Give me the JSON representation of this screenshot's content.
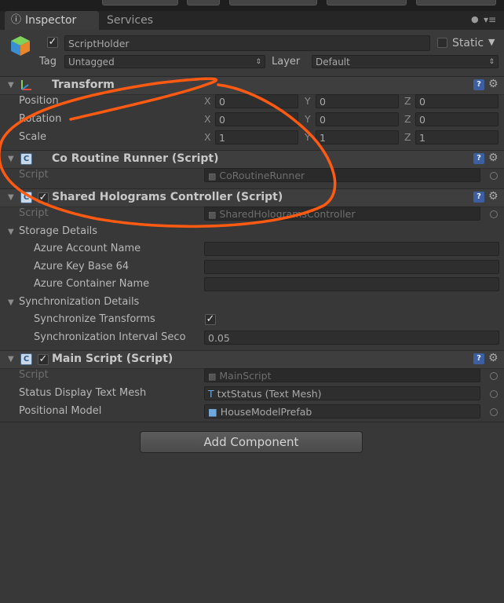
{
  "tabs": {
    "inspector": "Inspector",
    "services": "Services"
  },
  "icons": {
    "lock": "lock-icon",
    "menu": "tab-menu-icon"
  },
  "object": {
    "name": "ScriptHolder",
    "static_label": "Static"
  },
  "tag_layer": {
    "tag_label": "Tag",
    "tag_value": "Untagged",
    "layer_label": "Layer",
    "layer_value": "Default"
  },
  "transform": {
    "title": "Transform",
    "rows": [
      {
        "label": "Position",
        "x": "0",
        "y": "0",
        "z": "0"
      },
      {
        "label": "Rotation",
        "x": "0",
        "y": "0",
        "z": "0"
      },
      {
        "label": "Scale",
        "x": "1",
        "y": "1",
        "z": "1"
      }
    ],
    "axis": {
      "x": "X",
      "y": "Y",
      "z": "Z"
    }
  },
  "co_routine": {
    "title": "Co Routine Runner (Script)",
    "script_label": "Script",
    "script_value": "CoRoutineRunner"
  },
  "shared": {
    "title": "Shared Holograms Controller (Script)",
    "script_label": "Script",
    "script_value": "SharedHologramsController",
    "storage_label": "Storage Details",
    "account_label": "Azure Account Name",
    "key_label": "Azure Key Base 64",
    "container_label": "Azure Container Name",
    "sync_label": "Synchronization Details",
    "sync_transforms_label": "Synchronize Transforms",
    "sync_interval_label": "Synchronization Interval Seco",
    "sync_interval_value": "0.05"
  },
  "main_script": {
    "title": "Main Script (Script)",
    "script_label": "Script",
    "script_value": "MainScript",
    "status_label": "Status Display Text Mesh",
    "status_value": "txtStatus (Text Mesh)",
    "model_label": "Positional Model",
    "model_value": "HouseModelPrefab"
  },
  "add_component": "Add Component",
  "annotation_color": "#ff5a12"
}
